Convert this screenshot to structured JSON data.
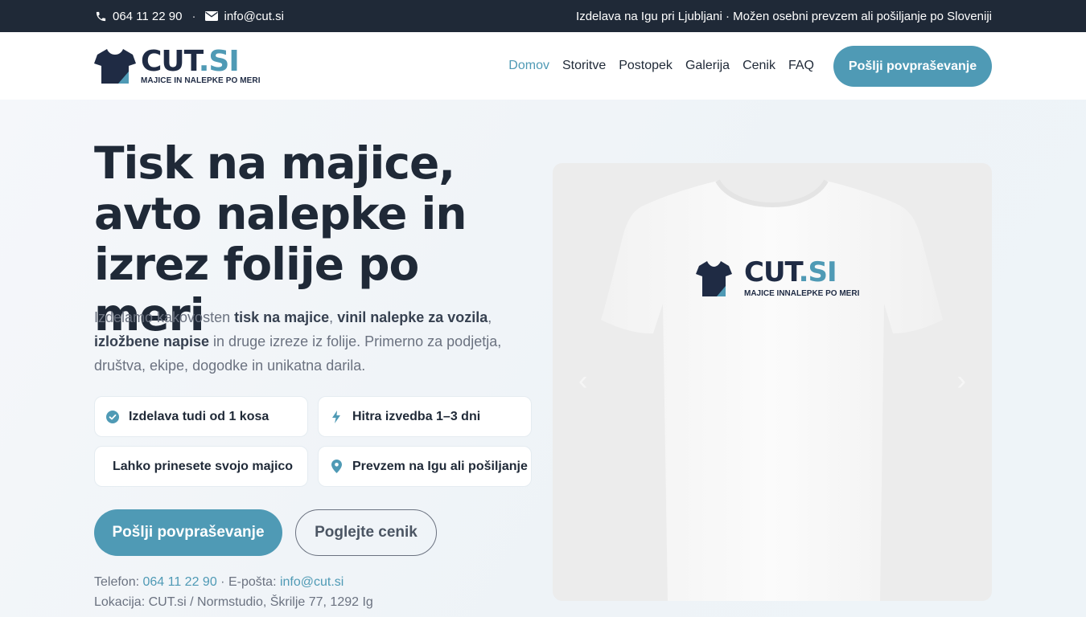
{
  "topbar": {
    "phone": "064 11 22 90",
    "separator": "·",
    "email": "info@cut.si",
    "tagline": "Izdelava na Igu pri Ljubljani · Možen osebni prevzem ali pošiljanje po Sloveniji"
  },
  "header": {
    "logo_name": "CUT",
    "logo_dot": ".SI",
    "logo_tagline": "MAJICE IN NALEPKE PO MERI",
    "nav": [
      "Domov",
      "Storitve",
      "Postopek",
      "Galerija",
      "Cenik",
      "FAQ"
    ],
    "cta": "Pošlji povpraševanje"
  },
  "hero": {
    "title_lines": [
      "Tisk na majice,",
      "avto nalepke in",
      "izrez folije po meri"
    ],
    "intro": {
      "p1": "Izdelamo kakovosten ",
      "b1": "tisk na majice",
      "p2": ", ",
      "b2": "vinil nalepke za vozila",
      "p3": ",",
      "b3": "izložbene napise",
      "p4": " in druge izreze iz folije. Primerno za podjetja, društva, ekipe, dogodke in unikatna darila."
    },
    "features": [
      {
        "label": "Izdelava tudi od 1 kosa",
        "icon": "check-circle-icon"
      },
      {
        "label": "Hitra izvedba 1–3 dni",
        "icon": "bolt-icon"
      },
      {
        "label": "Lahko prinesete svojo majico",
        "icon": ""
      },
      {
        "label": "Prevzem na Igu ali pošiljanje",
        "icon": "location-pin-icon"
      }
    ],
    "btn_primary": "Pošlji povpraševanje",
    "btn_secondary": "Poglejte cenik",
    "contact": {
      "phone_label": "Telefon: ",
      "phone": "064 11 22 90",
      "email_label": " · E-pošta: ",
      "email": "info@cut.si",
      "location": "Lokacija: CUT.si / Normstudio, Škrilje 77, 1292 Ig"
    },
    "image": {
      "shirt_brand": "CUT",
      "shirt_brand_dot": ".SI",
      "shirt_tagline": "MAJICE INNALEPKE PO MERI",
      "arrow_prev": "‹",
      "arrow_next": "›"
    }
  },
  "colors": {
    "accent": "#4f9ab5",
    "dark": "#1f2937",
    "navy": "#1f2b44"
  }
}
